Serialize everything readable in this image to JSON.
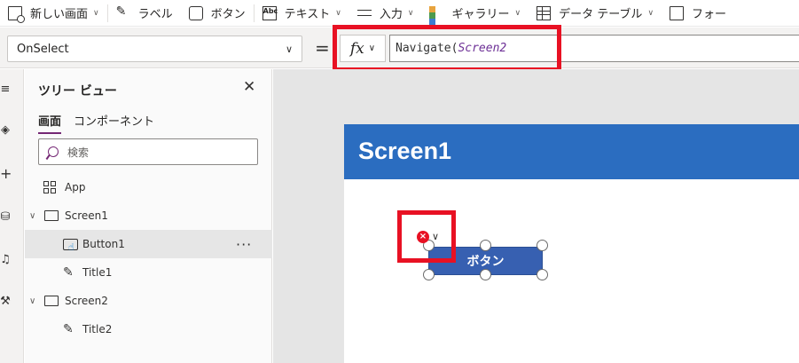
{
  "toolbar": {
    "items": [
      {
        "label": "新しい画面",
        "icon": "new-screen-icon"
      },
      {
        "label": "ラベル",
        "icon": "label-icon"
      },
      {
        "label": "ボタン",
        "icon": "button-icon"
      },
      {
        "label": "テキスト",
        "icon": "text-icon"
      },
      {
        "label": "入力",
        "icon": "input-icon"
      },
      {
        "label": "ギャラリー",
        "icon": "gallery-icon"
      },
      {
        "label": "データ テーブル",
        "icon": "table-icon"
      },
      {
        "label": "フォー",
        "icon": "form-icon"
      }
    ],
    "text_icon_glyph": "Abc"
  },
  "formula_bar": {
    "property": "OnSelect",
    "equals": "=",
    "fx": "fx",
    "formula_function": "Navigate(",
    "formula_argument": "Screen2"
  },
  "tree_view": {
    "title": "ツリー ビュー",
    "tabs": [
      "画面",
      "コンポーネント"
    ],
    "active_tab": "画面",
    "search_placeholder": "検索",
    "nodes": [
      {
        "label": "App",
        "type": "app"
      },
      {
        "label": "Screen1",
        "type": "screen",
        "expanded": true
      },
      {
        "label": "Button1",
        "type": "button",
        "selected": true
      },
      {
        "label": "Title1",
        "type": "label"
      },
      {
        "label": "Screen2",
        "type": "screen",
        "expanded": true
      },
      {
        "label": "Title2",
        "type": "label"
      }
    ],
    "more_options": "···"
  },
  "canvas": {
    "screen_title": "Screen1",
    "button_label": "ボタン",
    "error_badge": "×"
  },
  "colors": {
    "header_blue": "#2b6dc0",
    "button_blue": "#3760b1",
    "highlight_red": "#e81123",
    "accent_purple": "#742774"
  }
}
